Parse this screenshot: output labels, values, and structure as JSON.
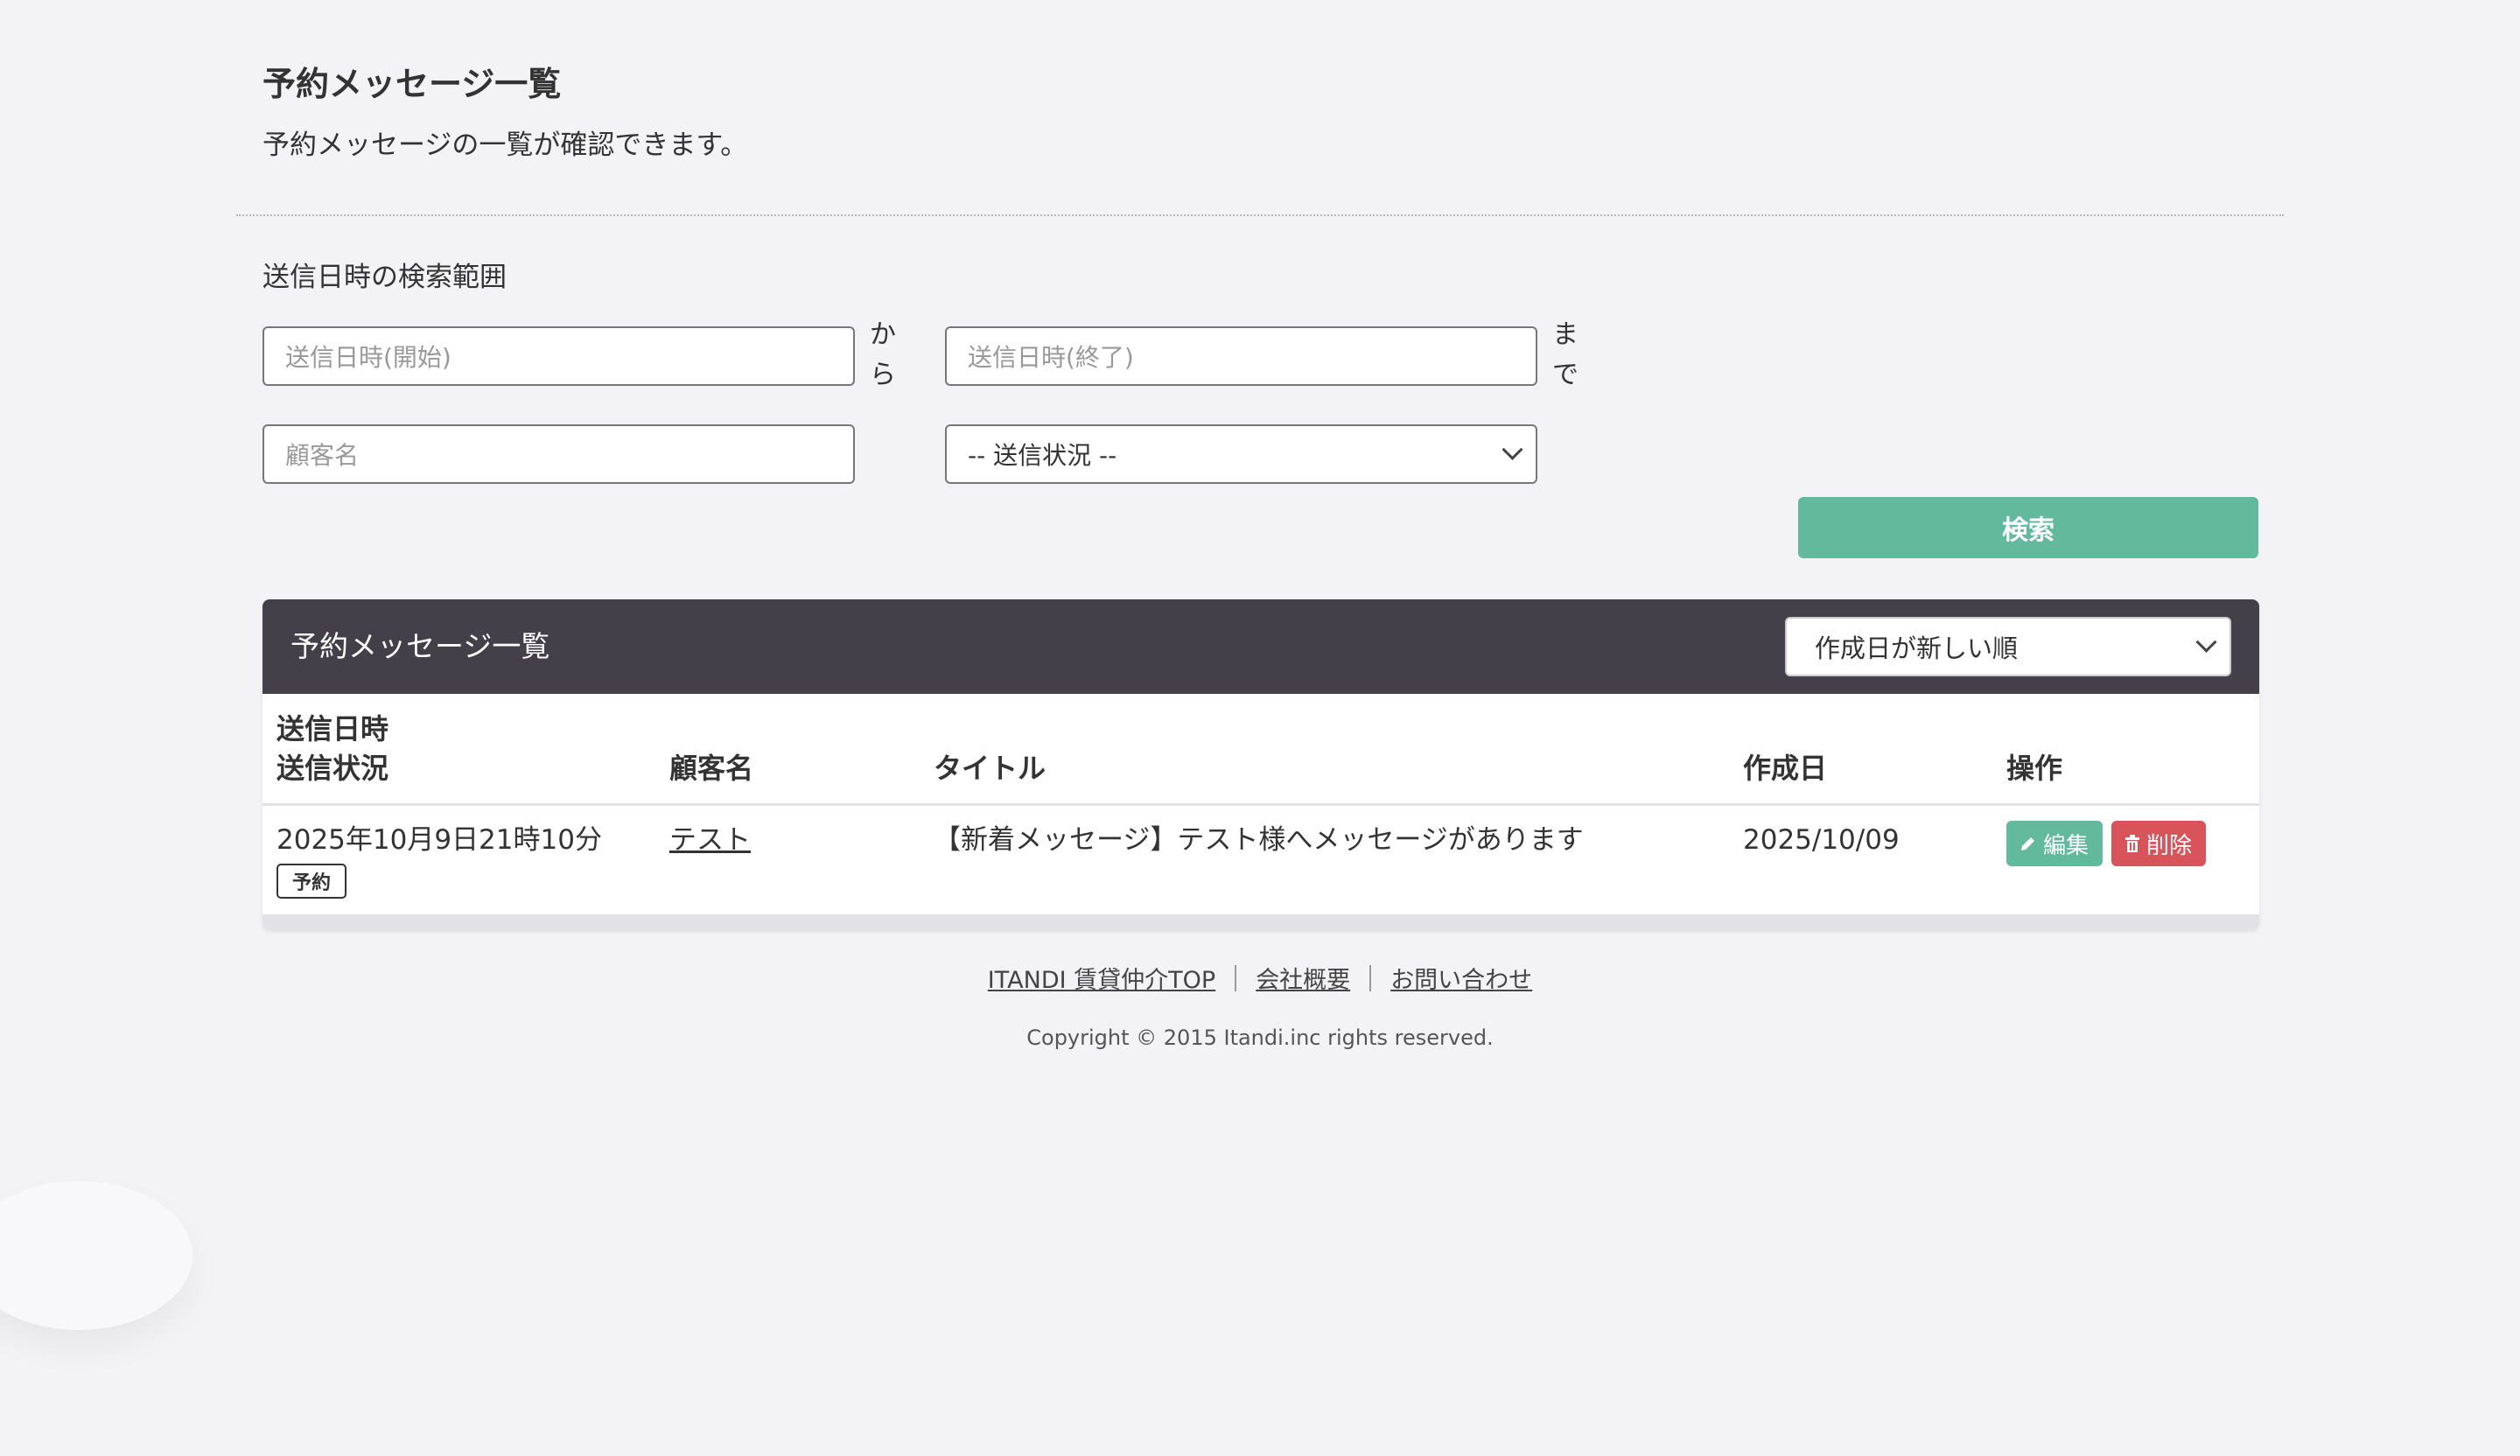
{
  "page": {
    "title": "予約メッセージ一覧",
    "subtitle": "予約メッセージの一覧が確認できます。"
  },
  "search": {
    "range_label": "送信日時の検索範囲",
    "start_placeholder": "送信日時(開始)",
    "from_text": "から",
    "end_placeholder": "送信日時(終了)",
    "until_text": "まで",
    "customer_placeholder": "顧客名",
    "status_selected": "-- 送信状況 --",
    "search_label": "検索"
  },
  "list": {
    "title": "予約メッセージ一覧",
    "sort_selected": "作成日が新しい順",
    "columns": {
      "sent_at": "送信日時",
      "status": "送信状況",
      "customer": "顧客名",
      "title": "タイトル",
      "created": "作成日",
      "actions": "操作"
    },
    "rows": [
      {
        "sent_at": "2025年10月9日21時10分",
        "status_badge": "予約",
        "customer": "テスト",
        "title": "【新着メッセージ】テスト様へメッセージがあります",
        "created": "2025/10/09",
        "edit_label": "編集",
        "delete_label": "削除"
      }
    ]
  },
  "footer": {
    "links": [
      "ITANDI 賃貸仲介TOP",
      "会社概要",
      "お問い合わせ"
    ],
    "copyright": "Copyright © 2015 Itandi.inc rights reserved."
  },
  "colors": {
    "accent_green": "#62b99c",
    "danger_red": "#d9535b",
    "header_dark": "#43404a",
    "background": "#f3f3f5"
  },
  "icons": {
    "edit": "pencil-icon",
    "delete": "trash-icon",
    "dropdown": "chevron-down-icon"
  }
}
